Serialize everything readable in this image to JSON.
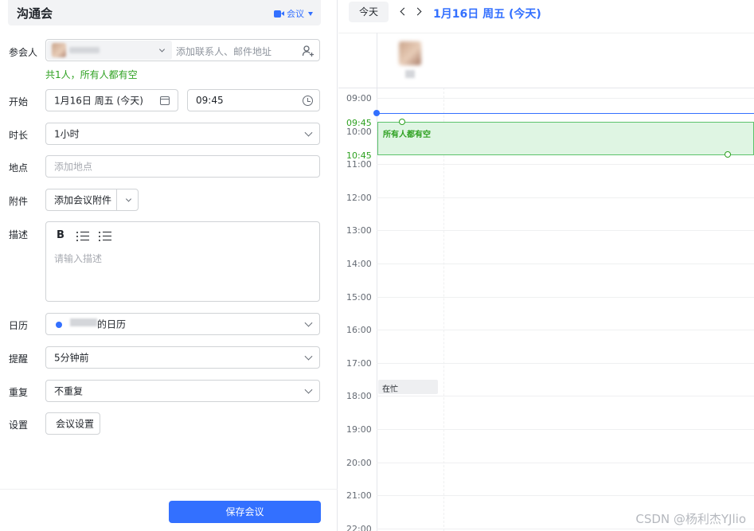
{
  "form": {
    "title": "沟通会",
    "meeting_type": "会议",
    "attendees": {
      "label": "参会人",
      "add_placeholder": "添加联系人、邮件地址",
      "availability_note": "共1人，所有人都有空"
    },
    "start": {
      "label": "开始",
      "date": "1月16日 周五 (今天)",
      "time": "09:45"
    },
    "duration": {
      "label": "时长",
      "value": "1小时"
    },
    "location": {
      "label": "地点",
      "placeholder": "添加地点"
    },
    "attachment": {
      "label": "附件",
      "button": "添加会议附件"
    },
    "description": {
      "label": "描述",
      "bold": "B",
      "placeholder": "请输入描述"
    },
    "calendar": {
      "label": "日历",
      "value": "的日历"
    },
    "reminder": {
      "label": "提醒",
      "value": "5分钟前"
    },
    "repeat": {
      "label": "重复",
      "value": "不重复"
    },
    "settings": {
      "label": "设置",
      "button": "会议设置"
    },
    "save_button": "保存会议"
  },
  "calendar_view": {
    "today_button": "今天",
    "date_title": "1月16日 周五 (今天)",
    "hours": [
      "09:00",
      "10:00",
      "11:00",
      "12:00",
      "13:00",
      "14:00",
      "15:00",
      "16:00",
      "17:00",
      "18:00",
      "19:00",
      "20:00",
      "21:00",
      "22:00"
    ],
    "event": {
      "label": "所有人都有空",
      "start": "09:45",
      "end": "10:45"
    },
    "busy_label": "在忙"
  },
  "watermark": "CSDN @杨利杰YJlio",
  "colors": {
    "accent": "#3370ff",
    "free_green": "#2ea121",
    "event_bg": "#dff5e3"
  }
}
